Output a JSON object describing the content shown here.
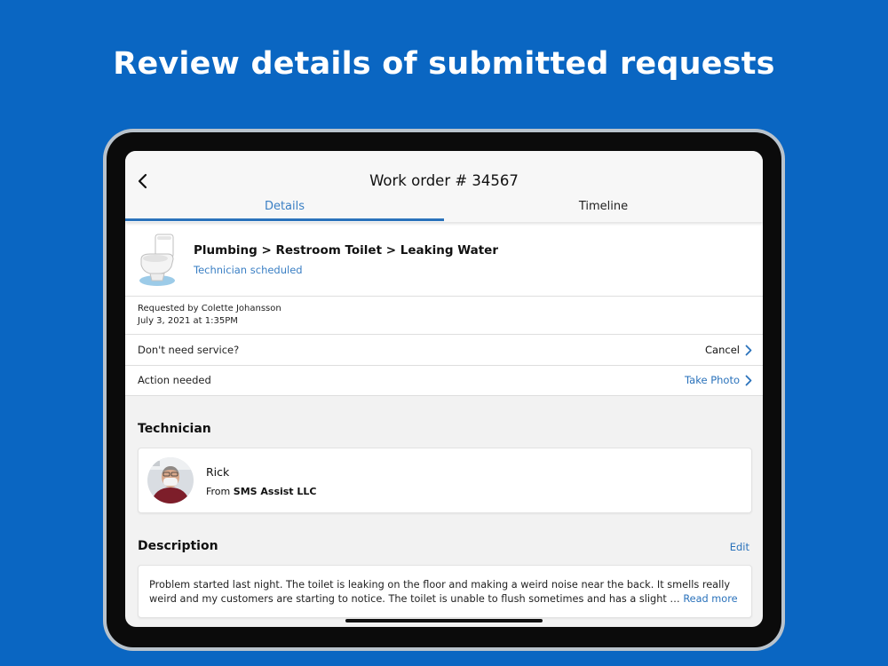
{
  "headline": "Review details of submitted requests",
  "header": {
    "title": "Work order # 34567",
    "tabs": [
      {
        "label": "Details",
        "active": true
      },
      {
        "label": "Timeline",
        "active": false
      }
    ]
  },
  "request": {
    "category": "Plumbing > Restroom Toilet > Leaking Water",
    "status": "Technician scheduled",
    "requested_by": "Requested by Colette Johansson",
    "requested_date": "July 3, 2021 at 1:35PM"
  },
  "rows": [
    {
      "label": "Don't need service?",
      "action": "Cancel"
    },
    {
      "label": "Action needed",
      "action": "Take Photo"
    }
  ],
  "technician": {
    "section_title": "Technician",
    "name": "Rick",
    "from_prefix": "From",
    "company": "SMS Assist LLC"
  },
  "description": {
    "section_title": "Description",
    "edit_label": "Edit",
    "text": "Problem started last night. The toilet is leaking on the floor and making a weird noise near the back. It smells really weird and my customers are starting to notice. The toilet is unable to flush sometimes and has a slight …",
    "read_more": "Read more"
  },
  "colors": {
    "background": "#0a66c2",
    "accent": "#2a72bb"
  },
  "icons": [
    "back-chevron-icon",
    "toilet-icon",
    "chevron-right-icon"
  ]
}
